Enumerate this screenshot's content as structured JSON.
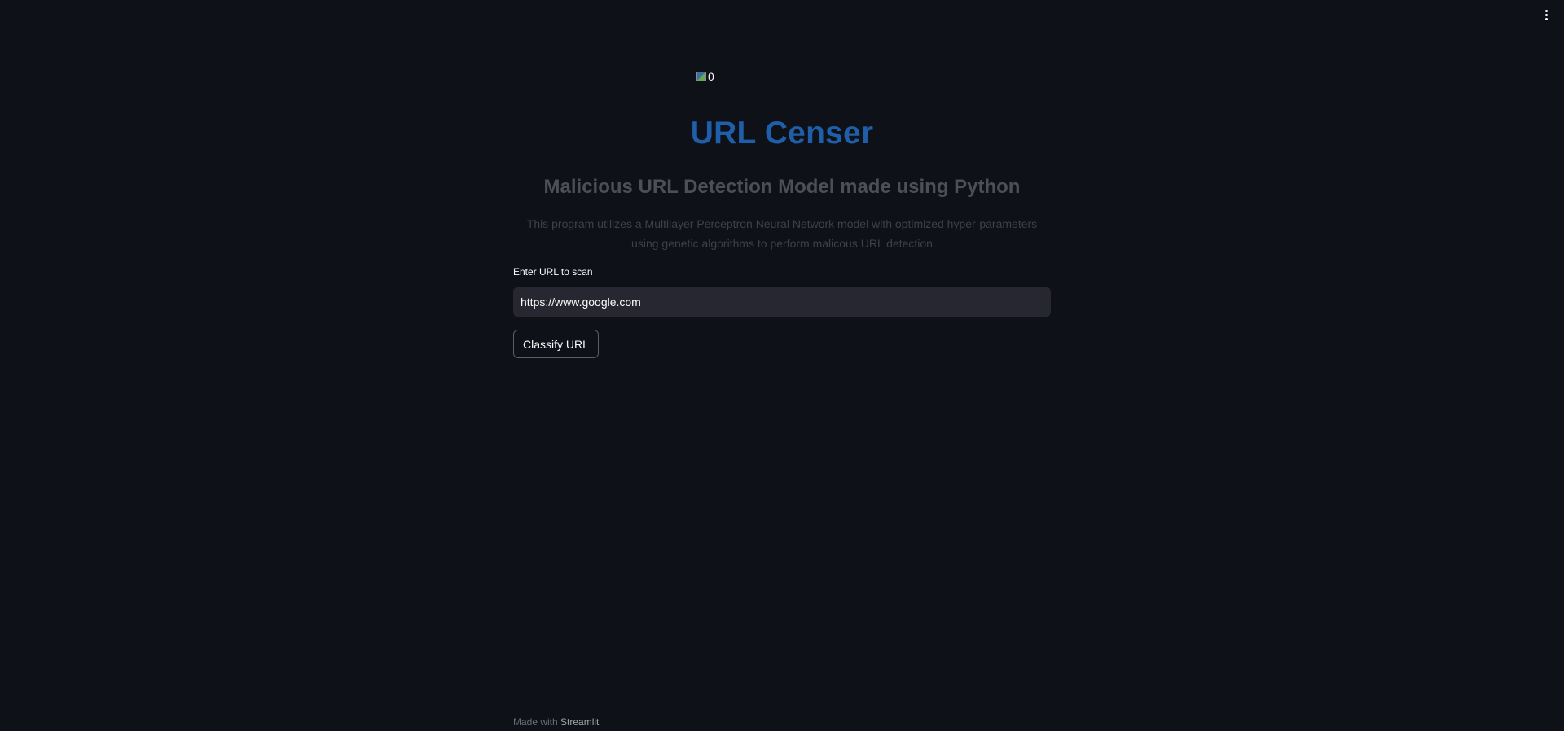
{
  "header": {
    "menu_icon": "kebab-menu-icon"
  },
  "logo": {
    "alt_text": "0",
    "icon": "broken-image-icon"
  },
  "title": "URL Censer",
  "subtitle": "Malicious URL Detection Model made using Python",
  "description": "This program utilizes a Multilayer Perceptron Neural Network model with optimized hyper-parameters using genetic algorithms to perform malicous URL detection",
  "form": {
    "input_label": "Enter URL to scan",
    "input_value": "https://www.google.com",
    "button_label": "Classify URL"
  },
  "footer": {
    "prefix": "Made with",
    "brand": "Streamlit"
  },
  "colors": {
    "background": "#0e1117",
    "title": "#1f5fa9",
    "input_background": "#262730"
  }
}
